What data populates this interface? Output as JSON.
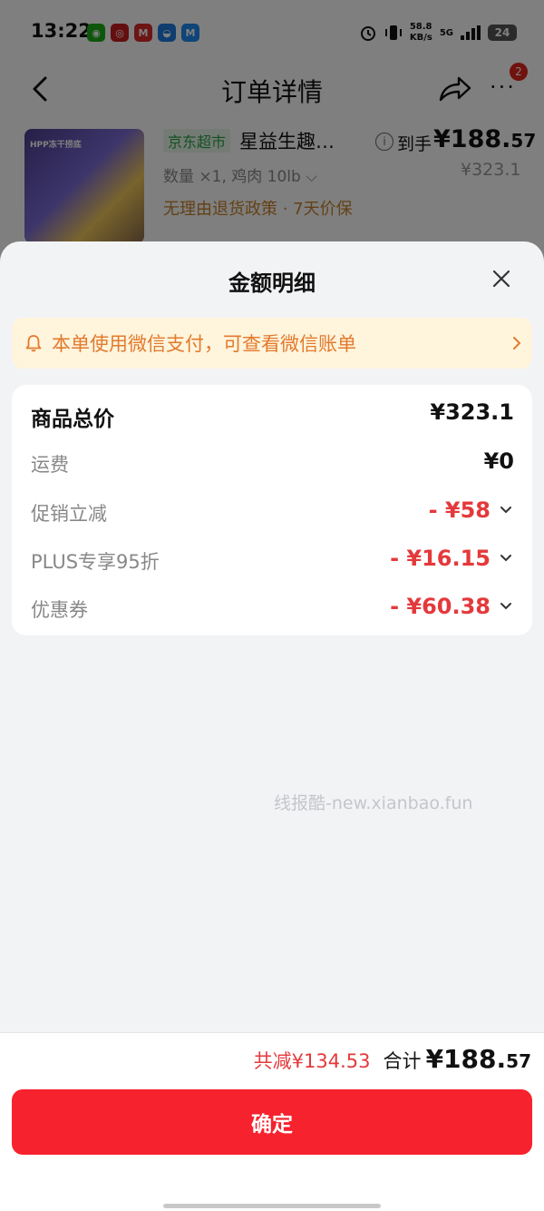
{
  "status_bar": {
    "time": "13:22",
    "speed_value": "58.8",
    "speed_unit": "KB/s",
    "network": "5G",
    "battery": "24"
  },
  "nav": {
    "title": "订单详情",
    "badge": "2",
    "more": "···"
  },
  "product": {
    "tag": "京东超市",
    "name": "星益生趣…",
    "price_label": "到手",
    "price_main": "¥188.",
    "price_decimal": "57",
    "original_price": "¥323.1",
    "quantity": "数量 ×1, 鸡肉 10lb ⌵",
    "policy": "无理由退货政策 · 7天价保",
    "image_text": "HPP冻干捞底"
  },
  "sheet": {
    "title": "金额明细",
    "notice": "本单使用微信支付，可查看微信账单",
    "rows": [
      {
        "label": "商品总价",
        "value": "¥323.1"
      },
      {
        "label": "运费",
        "value": "¥0"
      },
      {
        "label": "促销立减",
        "value": "- ¥58"
      },
      {
        "label": "PLUS专享95折",
        "value": "- ¥16.15"
      },
      {
        "label": "优惠券",
        "value": "- ¥60.38"
      }
    ],
    "watermark": "线报酷-new.xianbao.fun"
  },
  "footer": {
    "saved": "共减¥134.53",
    "total_label": "合计",
    "total_main": "¥188.",
    "total_decimal": "57",
    "confirm_label": "确定"
  },
  "colors": {
    "accent_red": "#f6222d",
    "discount_red": "#e4393c",
    "notice_bg": "#fff4dc",
    "notice_text": "#e27a2e"
  }
}
